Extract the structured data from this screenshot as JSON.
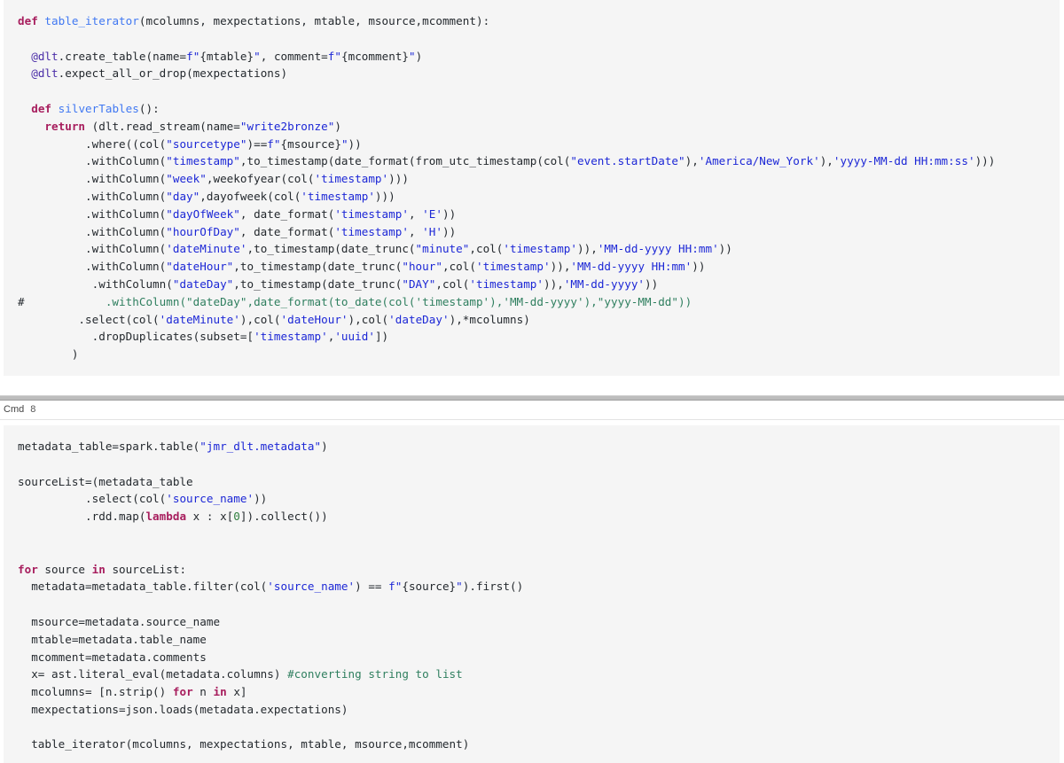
{
  "notebook": {
    "kind": "databricks-notebook",
    "theme": {
      "code_background": "#f5f5f5",
      "page_background": "#ffffff",
      "keyword_color": "#a71d5d",
      "function_color": "#4078f2",
      "decorator_color": "#4b2ea8",
      "string_color": "#1c27d6",
      "comment_color": "#2f7f5f",
      "number_color": "#2f7f3f",
      "text_color": "#24292e"
    }
  },
  "cells": [
    {
      "id": "cell-1",
      "header_visible": false,
      "cmd_label": "",
      "cmd_number": "",
      "lines": [
        [
          {
            "t": "def ",
            "c": "kw"
          },
          {
            "t": "table_iterator",
            "c": "fn"
          },
          {
            "t": "(mcolumns, mexpectations, mtable, msource,mcomment):",
            "c": "pl"
          }
        ],
        [],
        [
          {
            "t": "  ",
            "c": "pl"
          },
          {
            "t": "@dlt",
            "c": "deco"
          },
          {
            "t": ".create_table(name=",
            "c": "pl"
          },
          {
            "t": "f\"",
            "c": "str"
          },
          {
            "t": "{mtable}",
            "c": "pl"
          },
          {
            "t": "\"",
            "c": "str"
          },
          {
            "t": ", comment=",
            "c": "pl"
          },
          {
            "t": "f\"",
            "c": "str"
          },
          {
            "t": "{mcomment}",
            "c": "pl"
          },
          {
            "t": "\"",
            "c": "str"
          },
          {
            "t": ")",
            "c": "pl"
          }
        ],
        [
          {
            "t": "  ",
            "c": "pl"
          },
          {
            "t": "@dlt",
            "c": "deco"
          },
          {
            "t": ".expect_all_or_drop(mexpectations)",
            "c": "pl"
          }
        ],
        [],
        [
          {
            "t": "  ",
            "c": "pl"
          },
          {
            "t": "def ",
            "c": "kw"
          },
          {
            "t": "silverTables",
            "c": "fn"
          },
          {
            "t": "():",
            "c": "pl"
          }
        ],
        [
          {
            "t": "    ",
            "c": "pl"
          },
          {
            "t": "return ",
            "c": "kw"
          },
          {
            "t": "(dlt.read_stream(name=",
            "c": "pl"
          },
          {
            "t": "\"write2bronze\"",
            "c": "str"
          },
          {
            "t": ")",
            "c": "pl"
          }
        ],
        [
          {
            "t": "          .where((col(",
            "c": "pl"
          },
          {
            "t": "\"sourcetype\"",
            "c": "str"
          },
          {
            "t": ")==",
            "c": "pl"
          },
          {
            "t": "f\"",
            "c": "str"
          },
          {
            "t": "{msource}",
            "c": "pl"
          },
          {
            "t": "\"",
            "c": "str"
          },
          {
            "t": "))",
            "c": "pl"
          }
        ],
        [
          {
            "t": "          .withColumn(",
            "c": "pl"
          },
          {
            "t": "\"timestamp\"",
            "c": "str"
          },
          {
            "t": ",to_timestamp(date_format(from_utc_timestamp(col(",
            "c": "pl"
          },
          {
            "t": "\"event.startDate\"",
            "c": "str"
          },
          {
            "t": "),",
            "c": "pl"
          },
          {
            "t": "'America/New_York'",
            "c": "str"
          },
          {
            "t": "),",
            "c": "pl"
          },
          {
            "t": "'yyyy-MM-dd HH:mm:ss'",
            "c": "str"
          },
          {
            "t": ")))",
            "c": "pl"
          }
        ],
        [
          {
            "t": "          .withColumn(",
            "c": "pl"
          },
          {
            "t": "\"week\"",
            "c": "str"
          },
          {
            "t": ",weekofyear(col(",
            "c": "pl"
          },
          {
            "t": "'timestamp'",
            "c": "str"
          },
          {
            "t": ")))",
            "c": "pl"
          }
        ],
        [
          {
            "t": "          .withColumn(",
            "c": "pl"
          },
          {
            "t": "\"day\"",
            "c": "str"
          },
          {
            "t": ",dayofweek(col(",
            "c": "pl"
          },
          {
            "t": "'timestamp'",
            "c": "str"
          },
          {
            "t": ")))",
            "c": "pl"
          }
        ],
        [
          {
            "t": "          .withColumn(",
            "c": "pl"
          },
          {
            "t": "\"dayOfWeek\"",
            "c": "str"
          },
          {
            "t": ", date_format(",
            "c": "pl"
          },
          {
            "t": "'timestamp'",
            "c": "str"
          },
          {
            "t": ", ",
            "c": "pl"
          },
          {
            "t": "'E'",
            "c": "str"
          },
          {
            "t": "))",
            "c": "pl"
          }
        ],
        [
          {
            "t": "          .withColumn(",
            "c": "pl"
          },
          {
            "t": "\"hourOfDay\"",
            "c": "str"
          },
          {
            "t": ", date_format(",
            "c": "pl"
          },
          {
            "t": "'timestamp'",
            "c": "str"
          },
          {
            "t": ", ",
            "c": "pl"
          },
          {
            "t": "'H'",
            "c": "str"
          },
          {
            "t": "))",
            "c": "pl"
          }
        ],
        [
          {
            "t": "          .withColumn(",
            "c": "pl"
          },
          {
            "t": "'dateMinute'",
            "c": "str"
          },
          {
            "t": ",to_timestamp(date_trunc(",
            "c": "pl"
          },
          {
            "t": "\"minute\"",
            "c": "str"
          },
          {
            "t": ",col(",
            "c": "pl"
          },
          {
            "t": "'timestamp'",
            "c": "str"
          },
          {
            "t": ")),",
            "c": "pl"
          },
          {
            "t": "'MM-dd-yyyy HH:mm'",
            "c": "str"
          },
          {
            "t": "))",
            "c": "pl"
          }
        ],
        [
          {
            "t": "          .withColumn(",
            "c": "pl"
          },
          {
            "t": "\"dateHour\"",
            "c": "str"
          },
          {
            "t": ",to_timestamp(date_trunc(",
            "c": "pl"
          },
          {
            "t": "\"hour\"",
            "c": "str"
          },
          {
            "t": ",col(",
            "c": "pl"
          },
          {
            "t": "'timestamp'",
            "c": "str"
          },
          {
            "t": ")),",
            "c": "pl"
          },
          {
            "t": "'MM-dd-yyyy HH:mm'",
            "c": "str"
          },
          {
            "t": "))",
            "c": "pl"
          }
        ],
        [
          {
            "t": "           .withColumn(",
            "c": "pl"
          },
          {
            "t": "\"dateDay\"",
            "c": "str"
          },
          {
            "t": ",to_timestamp(date_trunc(",
            "c": "pl"
          },
          {
            "t": "\"DAY\"",
            "c": "str"
          },
          {
            "t": ",col(",
            "c": "pl"
          },
          {
            "t": "'timestamp'",
            "c": "str"
          },
          {
            "t": ")),",
            "c": "pl"
          },
          {
            "t": "'MM-dd-yyyy'",
            "c": "str"
          },
          {
            "t": "))",
            "c": "pl"
          }
        ],
        [
          {
            "t": "#",
            "c": "pl"
          },
          {
            "t": "            .withColumn(\"dateDay\",date_format(to_date(col('timestamp'),'MM-dd-yyyy'),\"yyyy-MM-dd\"))",
            "c": "cmt"
          }
        ],
        [
          {
            "t": "         .select(col(",
            "c": "pl"
          },
          {
            "t": "'dateMinute'",
            "c": "str"
          },
          {
            "t": "),col(",
            "c": "pl"
          },
          {
            "t": "'dateHour'",
            "c": "str"
          },
          {
            "t": "),col(",
            "c": "pl"
          },
          {
            "t": "'dateDay'",
            "c": "str"
          },
          {
            "t": "),*mcolumns)",
            "c": "pl"
          }
        ],
        [
          {
            "t": "           .dropDuplicates(subset=[",
            "c": "pl"
          },
          {
            "t": "'timestamp'",
            "c": "str"
          },
          {
            "t": ",",
            "c": "pl"
          },
          {
            "t": "'uuid'",
            "c": "str"
          },
          {
            "t": "])",
            "c": "pl"
          }
        ],
        [
          {
            "t": "        )",
            "c": "pl"
          }
        ]
      ]
    },
    {
      "id": "cell-2",
      "header_visible": true,
      "cmd_label": "Cmd",
      "cmd_number": "8",
      "lines": [
        [
          {
            "t": "metadata_table=spark.table(",
            "c": "pl"
          },
          {
            "t": "\"jmr_dlt.metadata\"",
            "c": "str"
          },
          {
            "t": ")",
            "c": "pl"
          }
        ],
        [],
        [
          {
            "t": "sourceList=(metadata_table",
            "c": "pl"
          }
        ],
        [
          {
            "t": "          .select(col(",
            "c": "pl"
          },
          {
            "t": "'source_name'",
            "c": "str"
          },
          {
            "t": "))",
            "c": "pl"
          }
        ],
        [
          {
            "t": "          .rdd.map(",
            "c": "pl"
          },
          {
            "t": "lambda",
            "c": "kw"
          },
          {
            "t": " x : x[",
            "c": "pl"
          },
          {
            "t": "0",
            "c": "num"
          },
          {
            "t": "]).collect())",
            "c": "pl"
          }
        ],
        [],
        [],
        [
          {
            "t": "for ",
            "c": "kw"
          },
          {
            "t": "source ",
            "c": "pl"
          },
          {
            "t": "in ",
            "c": "kw"
          },
          {
            "t": "sourceList:",
            "c": "pl"
          }
        ],
        [
          {
            "t": "  metadata=metadata_table.filter(col(",
            "c": "pl"
          },
          {
            "t": "'source_name'",
            "c": "str"
          },
          {
            "t": ") == ",
            "c": "pl"
          },
          {
            "t": "f\"",
            "c": "str"
          },
          {
            "t": "{source}",
            "c": "pl"
          },
          {
            "t": "\"",
            "c": "str"
          },
          {
            "t": ").first()",
            "c": "pl"
          }
        ],
        [],
        [
          {
            "t": "  msource=metadata.source_name",
            "c": "pl"
          }
        ],
        [
          {
            "t": "  mtable=metadata.table_name",
            "c": "pl"
          }
        ],
        [
          {
            "t": "  mcomment=metadata.comments",
            "c": "pl"
          }
        ],
        [
          {
            "t": "  x= ast.literal_eval(metadata.columns) ",
            "c": "pl"
          },
          {
            "t": "#converting string to list",
            "c": "cmt"
          }
        ],
        [
          {
            "t": "  mcolumns= [n.strip() ",
            "c": "pl"
          },
          {
            "t": "for ",
            "c": "kw"
          },
          {
            "t": "n ",
            "c": "pl"
          },
          {
            "t": "in ",
            "c": "kw"
          },
          {
            "t": "x]",
            "c": "pl"
          }
        ],
        [
          {
            "t": "  mexpectations=json.loads(metadata.expectations)",
            "c": "pl"
          }
        ],
        [],
        [
          {
            "t": "  table_iterator(mcolumns, mexpectations, mtable, msource,mcomment)",
            "c": "pl"
          }
        ]
      ]
    }
  ]
}
